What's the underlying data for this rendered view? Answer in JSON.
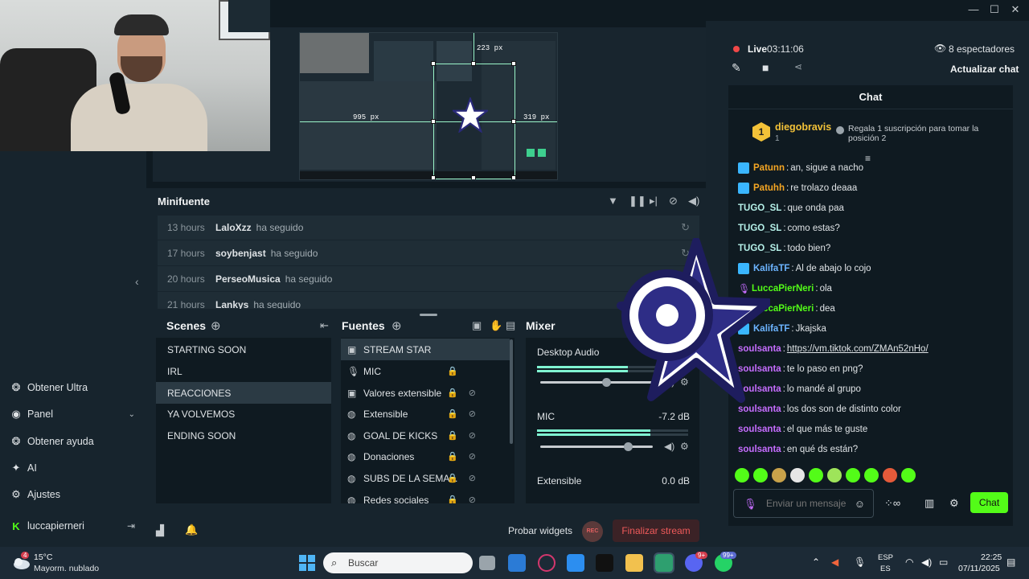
{
  "sidebar": {
    "items": [
      {
        "label": "Obtener Ultra",
        "icon": "gift-icon"
      },
      {
        "label": "Panel",
        "icon": "dashboard-icon"
      },
      {
        "label": "Obtener ayuda",
        "icon": "help-icon"
      },
      {
        "label": "AI",
        "icon": "sparkle-icon"
      },
      {
        "label": "Ajustes",
        "icon": "gear-icon"
      },
      {
        "label": "luccapierneri",
        "icon": "kick-logo-icon"
      }
    ]
  },
  "preview": {
    "measure_top": "223 px",
    "measure_left": "995 px",
    "measure_right": "319 px"
  },
  "minifuente": {
    "title": "Minifuente",
    "rows": [
      {
        "time": "13 hours",
        "user": "LaloXzz",
        "action": "ha seguido"
      },
      {
        "time": "17 hours",
        "user": "soybenjast",
        "action": "ha seguido"
      },
      {
        "time": "20 hours",
        "user": "PerseoMusica",
        "action": "ha seguido"
      },
      {
        "time": "21 hours",
        "user": "Lankys",
        "action": "ha seguido"
      }
    ]
  },
  "scenes": {
    "title": "Scenes",
    "items": [
      "STARTING SOON",
      "IRL",
      "REACCIONES",
      "YA VOLVEMOS",
      "ENDING SOON"
    ],
    "selected": "REACCIONES"
  },
  "sources": {
    "title": "Fuentes",
    "items": [
      {
        "label": "STREAM STAR",
        "icon": "image-icon"
      },
      {
        "label": "MIC",
        "icon": "mic-icon"
      },
      {
        "label": "Valores extensible",
        "icon": "image-icon"
      },
      {
        "label": "Extensible",
        "icon": "globe-icon"
      },
      {
        "label": "GOAL DE KICKS",
        "icon": "globe-icon"
      },
      {
        "label": "Donaciones",
        "icon": "globe-icon"
      },
      {
        "label": "SUBS DE LA SEMA...",
        "icon": "globe-icon"
      },
      {
        "label": "Redes sociales",
        "icon": "globe-icon"
      }
    ]
  },
  "mixer": {
    "title": "Mixer",
    "channels": [
      {
        "name": "Desktop Audio",
        "db": "",
        "level": 0.6,
        "volume": 0.55
      },
      {
        "name": "MIC",
        "db": "-7.2 dB",
        "level": 0.75,
        "volume": 0.74
      },
      {
        "name": "Extensible",
        "db": "0.0 dB",
        "level": 0,
        "volume": 0
      }
    ]
  },
  "statusbar": {
    "test_widgets": "Probar widgets",
    "rec": "REC",
    "end_stream": "Finalizar stream"
  },
  "stream": {
    "live_label": "Live",
    "live_time": "03:11:06",
    "viewers": "8 espectadores",
    "update_chat": "Actualizar chat"
  },
  "chat": {
    "title": "Chat",
    "gifter": {
      "rank": "1",
      "name": "diegobravis",
      "count": "1",
      "message": "Regala 1 suscripción para tomar la posición 2"
    },
    "messages": [
      {
        "user": "Patunn",
        "text": "an, sigue a nacho",
        "color": "#f5a623",
        "badge": "sub"
      },
      {
        "user": "Patuhh",
        "text": "re trolazo deaaa",
        "color": "#f5a623",
        "badge": "sub"
      },
      {
        "user": "TUGO_SL",
        "text": "que onda paa",
        "color": "#b5f0e8",
        "badge": ""
      },
      {
        "user": "TUGO_SL",
        "text": "como estas?",
        "color": "#b5f0e8",
        "badge": ""
      },
      {
        "user": "TUGO_SL",
        "text": "todo bien?",
        "color": "#b5f0e8",
        "badge": ""
      },
      {
        "user": "KalifaTF",
        "text": "Al de abajo lo cojo",
        "color": "#6cb4ff",
        "badge": "sub"
      },
      {
        "user": "LuccaPierNeri",
        "text": "ola",
        "color": "#53fc18",
        "badge": "mic"
      },
      {
        "user": "LuccaPierNeri",
        "text": "dea",
        "color": "#53fc18",
        "badge": "mic"
      },
      {
        "user": "KalifaTF",
        "text": "Jkajska",
        "color": "#6cb4ff",
        "badge": "sub"
      },
      {
        "user": "soulsanta",
        "text": "https://vm.tiktok.com/ZMAn52nHo/",
        "color": "#c66dff",
        "badge": "",
        "link": true
      },
      {
        "user": "soulsanta",
        "text": "te lo paso en png?",
        "color": "#c66dff",
        "badge": ""
      },
      {
        "user": "soulsanta",
        "text": "lo mandé al grupo",
        "color": "#c66dff",
        "badge": ""
      },
      {
        "user": "soulsanta",
        "text": "los dos son de distinto color",
        "color": "#c66dff",
        "badge": ""
      },
      {
        "user": "soulsanta",
        "text": "el que más te guste",
        "color": "#c66dff",
        "badge": ""
      },
      {
        "user": "soulsanta",
        "text": "en qué ds están?",
        "color": "#c66dff",
        "badge": ""
      }
    ],
    "input_placeholder": "Enviar un mensaje",
    "send_label": "Chat",
    "emote_colors": [
      "#53fc18",
      "#53fc18",
      "#c8a24a",
      "#e6e6e6",
      "#53fc18",
      "#9ee45a",
      "#53fc18",
      "#53fc18",
      "#e55a3a",
      "#53fc18"
    ]
  },
  "taskbar": {
    "weather_temp": "15°C",
    "weather_desc": "Mayorm. nublado",
    "weather_badge": "4",
    "search_placeholder": "Buscar",
    "lang_line1": "ESP",
    "lang_line2": "ES",
    "time": "22:25",
    "date": "07/11/2025",
    "badge_discord": "9+",
    "badge_whatsapp": "99+"
  },
  "colors": {
    "kick_green": "#53fc18",
    "end_stream_red": "#f05a5a",
    "panel_bg": "#17242d",
    "dock_bg": "#0f1a21"
  }
}
